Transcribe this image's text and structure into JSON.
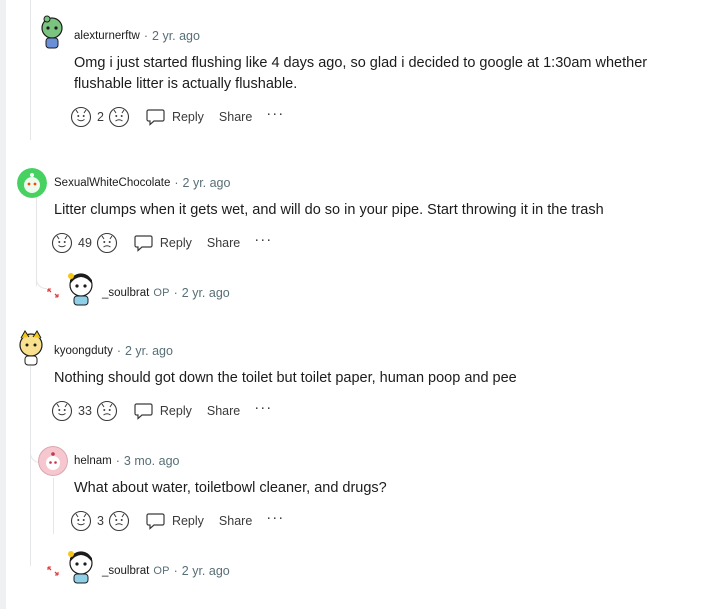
{
  "comments": [
    {
      "username": "alexturnerftw",
      "time": "2 yr. ago",
      "text": "Omg i just started flushing like 4 days ago, so glad i decided to google at 1:30am whether flushable litter is actually flushable.",
      "votes": "2",
      "reply_label": "Reply",
      "share_label": "Share",
      "avatar_color": "#6dbf7b"
    },
    {
      "username": "SexualWhiteChocolate",
      "time": "2 yr. ago",
      "text": "Litter clumps when it gets wet, and will do so in your pipe. Start throwing it in the trash",
      "votes": "49",
      "reply_label": "Reply",
      "share_label": "Share",
      "avatar_color": "#46d160"
    },
    {
      "username": "_soulbrat",
      "op_badge": "OP",
      "time": "2 yr. ago"
    },
    {
      "username": "kyoongduty",
      "time": "2 yr. ago",
      "text": "Nothing should got down the toilet but toilet paper, human poop and pee",
      "votes": "33",
      "reply_label": "Reply",
      "share_label": "Share",
      "avatar_color": "#f5c518"
    },
    {
      "username": "helnam",
      "time": "3 mo. ago",
      "text": "What about water, toiletbowl cleaner, and drugs?",
      "votes": "3",
      "reply_label": "Reply",
      "share_label": "Share",
      "avatar_color": "#f3b5c0"
    },
    {
      "username": "_soulbrat",
      "op_badge": "OP",
      "time": "2 yr. ago"
    }
  ],
  "separator": "·",
  "more_label": "···",
  "colors": {
    "meta": "#576f76",
    "thread_line": "#e4e6e8",
    "text": "#1c1c1c",
    "collapse_arrow": "#e03a3a"
  }
}
